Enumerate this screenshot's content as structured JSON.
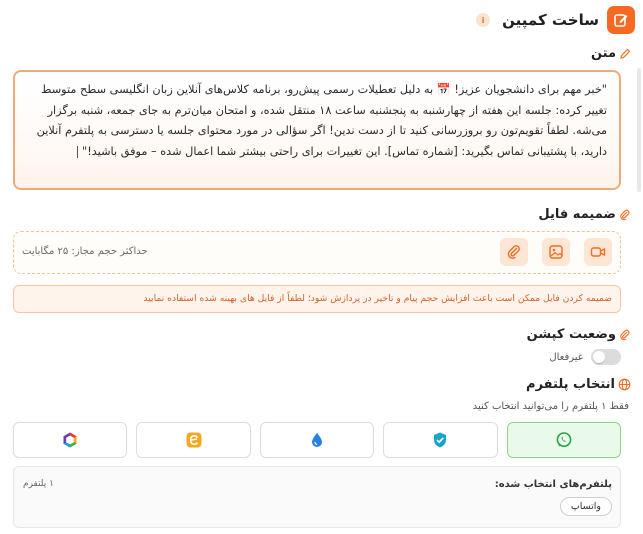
{
  "header": {
    "title": "ساخت کمپین",
    "info_glyph": "i"
  },
  "message": {
    "label": "متن",
    "text": "\"خبر مهم برای دانشجویان عزیز! 📅 به دلیل تعطیلات رسمی پیش‌رو، برنامه کلاس‌های آنلاین زبان انگلیسی سطح متوسط تغییر کرده: جلسه این هفته از چهارشنبه به پنجشنبه ساعت ۱۸ منتقل شده، و امتحان میان‌ترم به جای جمعه، شنبه برگزار می‌شه. لطفاً تقویم‌تون رو بروزرسانی کنید تا از دست ندین! اگر سؤالی در مورد محتوای جلسه یا دسترسی به پلتفرم آنلاین دارید، با پشتیبانی تماس بگیرید: [شماره تماس]. این تغییرات برای راحتی بیشتر شما اعمال شده – موفق باشید!\""
  },
  "attachment": {
    "label": "ضمیمه فایل",
    "max_size_hint": "حداکثر حجم مجاز: ۲۵ مگابایت",
    "buttons": [
      "video-icon",
      "image-icon",
      "paperclip-icon"
    ],
    "warning": "ضمیمه کردن فایل ممکن است باعث افزایش حجم پیام و تاخیر در پردازش شود؛ لطفاً از فایل های بهینه شده استفاده نمایید"
  },
  "caption_status": {
    "label": "وضعیت کپشن",
    "toggle_label": "غیرفعال",
    "enabled": false
  },
  "platforms": {
    "label": "انتخاب پلتفرم",
    "hint": "فقط ۱ پلتفرم را می‌توانید انتخاب کنید",
    "items": [
      {
        "icon": "whatsapp-icon",
        "selected": true,
        "color": "#25a244"
      },
      {
        "icon": "shield-check-icon",
        "selected": false,
        "color": "#1aa3c8"
      },
      {
        "icon": "drop-icon",
        "selected": false,
        "color": "#2b7de9"
      },
      {
        "icon": "eitaa-icon",
        "selected": false,
        "color": "#f4a81d"
      },
      {
        "icon": "rubika-icon",
        "selected": false,
        "color": "#6c3fb0"
      }
    ],
    "selected_title": "پلتفرم‌های انتخاب شده:",
    "selected_count": "۱ پلتفرم",
    "selected_chip": "واتساپ"
  },
  "colors": {
    "accent": "#f46a22",
    "whatsapp": "#25d366",
    "warning_text": "#d4632a"
  }
}
